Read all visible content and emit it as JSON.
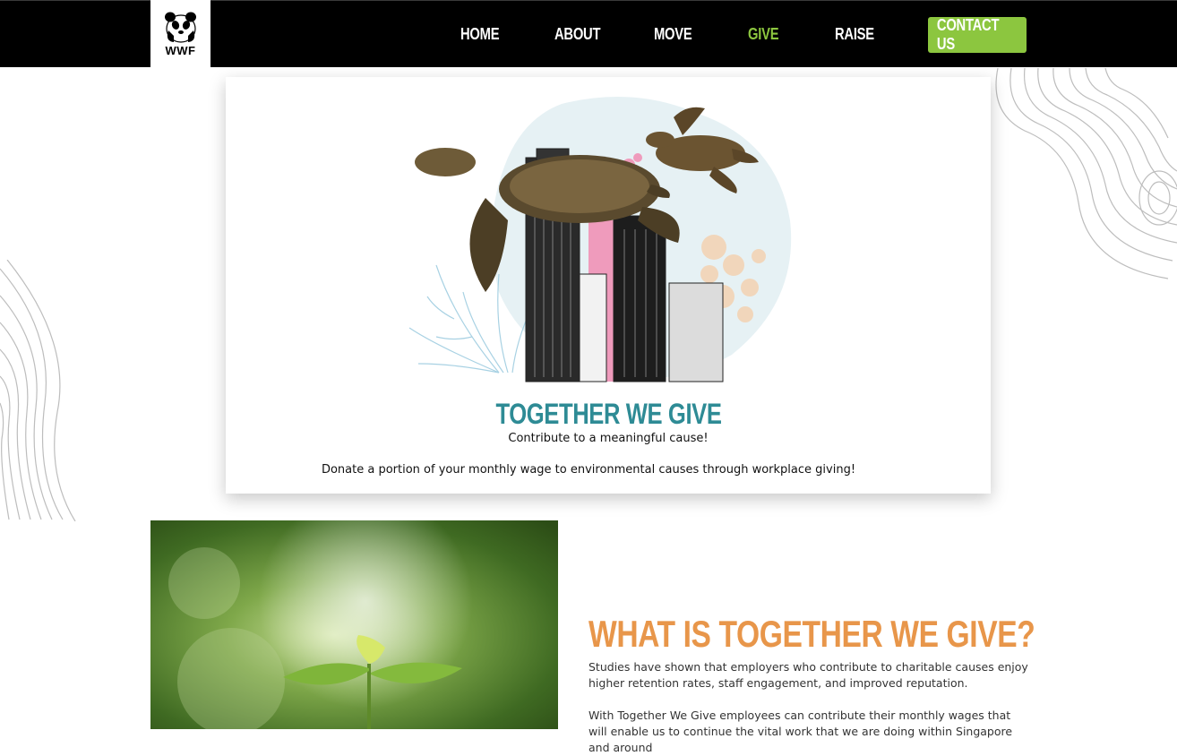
{
  "header": {
    "logo_text": "WWF",
    "nav": [
      "HOME",
      "ABOUT",
      "MOVE",
      "GIVE",
      "RAISE"
    ],
    "active_nav": "GIVE",
    "contact_label": "CONTACT US"
  },
  "hero": {
    "title": "TOGETHER WE GIVE",
    "subtitle": "Contribute to a meaningful cause!",
    "description": "Donate a portion of your monthly wage to environmental causes through workplace giving!"
  },
  "about": {
    "heading": "WHAT IS TOGETHER WE GIVE?",
    "paragraph1": "Studies have shown that employers who contribute to charitable causes enjoy higher retention rates, staff engagement, and improved reputation.",
    "paragraph2": "With Together We Give employees can contribute their monthly wages that will enable us to continue the vital work that we are doing within Singapore and around"
  },
  "colors": {
    "accent_green": "#8cc63f",
    "teal_title": "#2e8b95",
    "orange_heading": "#e8964a",
    "header_bg": "#000000"
  }
}
